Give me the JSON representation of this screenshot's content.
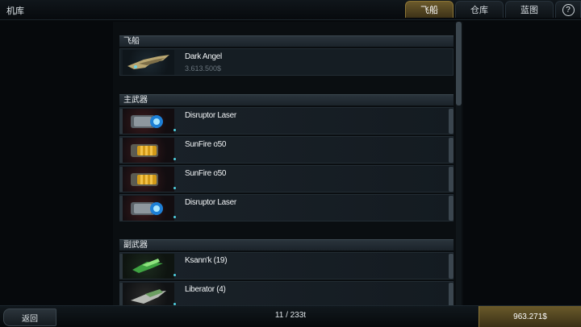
{
  "header": {
    "title": "机库",
    "tabs": [
      {
        "label": "飞船",
        "active": true
      },
      {
        "label": "仓库",
        "active": false
      },
      {
        "label": "蓝图",
        "active": false
      }
    ],
    "help_label": "?"
  },
  "sections": {
    "ship": {
      "title": "飞船",
      "items": [
        {
          "name": "Dark Angel",
          "price": "3.613.500$",
          "icon": "ship-icon"
        }
      ]
    },
    "primary": {
      "title": "主武器",
      "items": [
        {
          "name": "Disruptor Laser",
          "icon": "laser-icon-blue"
        },
        {
          "name": "SunFire o50",
          "icon": "cannon-icon-orange"
        },
        {
          "name": "SunFire o50",
          "icon": "cannon-icon-orange"
        },
        {
          "name": "Disruptor Laser",
          "icon": "laser-icon-blue"
        }
      ]
    },
    "secondary": {
      "title": "副武器",
      "items": [
        {
          "name": "Ksann'k (19)",
          "icon": "missile-icon-green"
        },
        {
          "name": "Liberator (4)",
          "icon": "missile-icon-grey"
        }
      ]
    }
  },
  "footer": {
    "back_label": "返回",
    "count": "11 / 233t",
    "money": "963.271$"
  },
  "colors": {
    "accent_gold": "#6b5a2c",
    "panel": "#0a0e11",
    "highlight": "#4fd0e0"
  }
}
